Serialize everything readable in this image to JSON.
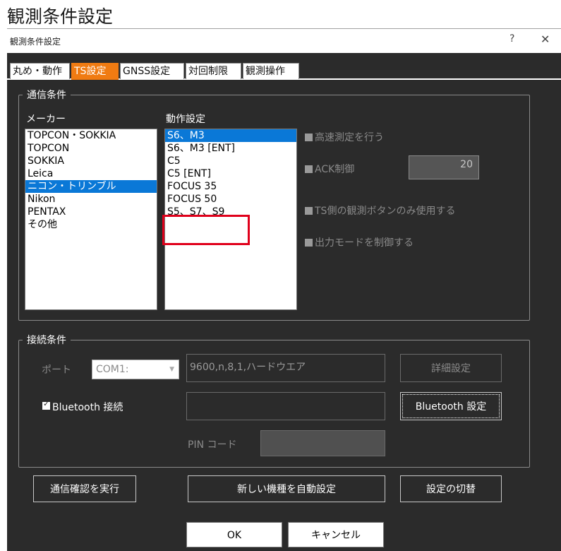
{
  "page": {
    "heading": "観測条件設定"
  },
  "window": {
    "title": "観測条件設定",
    "help": "?",
    "close": "✕"
  },
  "tabs": [
    "丸め・動作",
    "TS設定",
    "GNSS設定",
    "対回制限",
    "観測操作"
  ],
  "comm": {
    "group_title": "通信条件",
    "maker_label": "メーカー",
    "makers": [
      "TOPCON・SOKKIA",
      "TOPCON",
      "SOKKIA",
      "Leica",
      "ニコン・トリンブル",
      "Nikon",
      "PENTAX",
      "その他"
    ],
    "selected_maker": "ニコン・トリンブル",
    "op_label": "動作設定",
    "ops": [
      "S6、M3",
      "S6、M3 [ENT]",
      "C5",
      "C5 [ENT]",
      "FOCUS 35",
      "FOCUS 50",
      "S5、S7、S9"
    ],
    "selected_op": "S6、M3",
    "options": {
      "fast": "高速測定を行う",
      "ack": "ACK制御",
      "ack_value": "20",
      "ts_button": "TS側の観測ボタンのみ使用する",
      "output_mode": "出力モードを制御する"
    }
  },
  "conn": {
    "group_title": "接続条件",
    "port_label": "ポート",
    "port_value": "COM1:",
    "port_settings": "9600,n,8,1,ハードウエア",
    "detail_button": "詳細設定",
    "bt_label": "Bluetooth 接続",
    "bt_checked": true,
    "bt_button": "Bluetooth 設定",
    "pin_label": "PIN コード"
  },
  "actions": {
    "test": "通信確認を実行",
    "auto": "新しい機種を自動設定",
    "switch": "設定の切替"
  },
  "footer": {
    "ok": "OK",
    "cancel": "キャンセル"
  },
  "colors": {
    "accent": "#f07b12",
    "selection": "#0a78d7",
    "highlight": "#e0001b",
    "background": "#2b2b2b"
  }
}
